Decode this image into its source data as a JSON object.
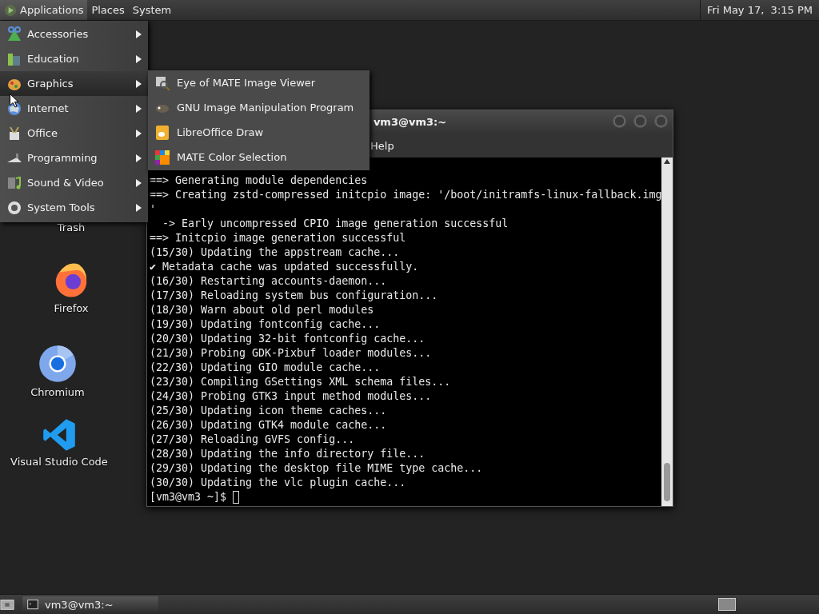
{
  "top_panel": {
    "menus": [
      {
        "label": "Applications",
        "selected": true
      },
      {
        "label": "Places",
        "selected": false
      },
      {
        "label": "System",
        "selected": false
      }
    ],
    "clock": "Fri May 17,  3:15 PM"
  },
  "desktop_icons": [
    {
      "label": "Trash"
    },
    {
      "label": "Firefox"
    },
    {
      "label": "Chromium"
    },
    {
      "label": "Visual Studio Code"
    }
  ],
  "terminal": {
    "title": "vm3@vm3:~",
    "menu": [
      "Help"
    ],
    "lines": [
      "==> Generating module dependencies",
      "==> Creating zstd-compressed initcpio image: '/boot/initramfs-linux-fallback.img",
      "'",
      "  -> Early uncompressed CPIO image generation successful",
      "==> Initcpio image generation successful",
      "(15/30) Updating the appstream cache...",
      "✔ Metadata cache was updated successfully.",
      "(16/30) Restarting accounts-daemon...",
      "(17/30) Reloading system bus configuration...",
      "(18/30) Warn about old perl modules",
      "(19/30) Updating fontconfig cache...",
      "(20/30) Updating 32-bit fontconfig cache...",
      "(21/30) Probing GDK-Pixbuf loader modules...",
      "(22/30) Updating GIO module cache...",
      "(23/30) Compiling GSettings XML schema files...",
      "(24/30) Probing GTK3 input method modules...",
      "(25/30) Updating icon theme caches...",
      "(26/30) Updating GTK4 module cache...",
      "(27/30) Reloading GVFS config...",
      "(28/30) Updating the info directory file...",
      "(29/30) Updating the desktop file MIME type cache...",
      "(30/30) Updating the vlc plugin cache..."
    ],
    "prompt": "[vm3@vm3 ~]$ "
  },
  "applications_menu": {
    "items": [
      {
        "label": "Accessories",
        "selected": false
      },
      {
        "label": "Education",
        "selected": false
      },
      {
        "label": "Graphics",
        "selected": true
      },
      {
        "label": "Internet",
        "selected": false
      },
      {
        "label": "Office",
        "selected": false
      },
      {
        "label": "Programming",
        "selected": false
      },
      {
        "label": "Sound & Video",
        "selected": false
      },
      {
        "label": "System Tools",
        "selected": false
      }
    ]
  },
  "graphics_submenu": {
    "items": [
      {
        "label": "Eye of MATE Image Viewer"
      },
      {
        "label": "GNU Image Manipulation Program"
      },
      {
        "label": "LibreOffice Draw"
      },
      {
        "label": "MATE Color Selection"
      }
    ]
  },
  "taskbar": {
    "tasks": [
      {
        "label": "vm3@vm3:~"
      }
    ]
  }
}
